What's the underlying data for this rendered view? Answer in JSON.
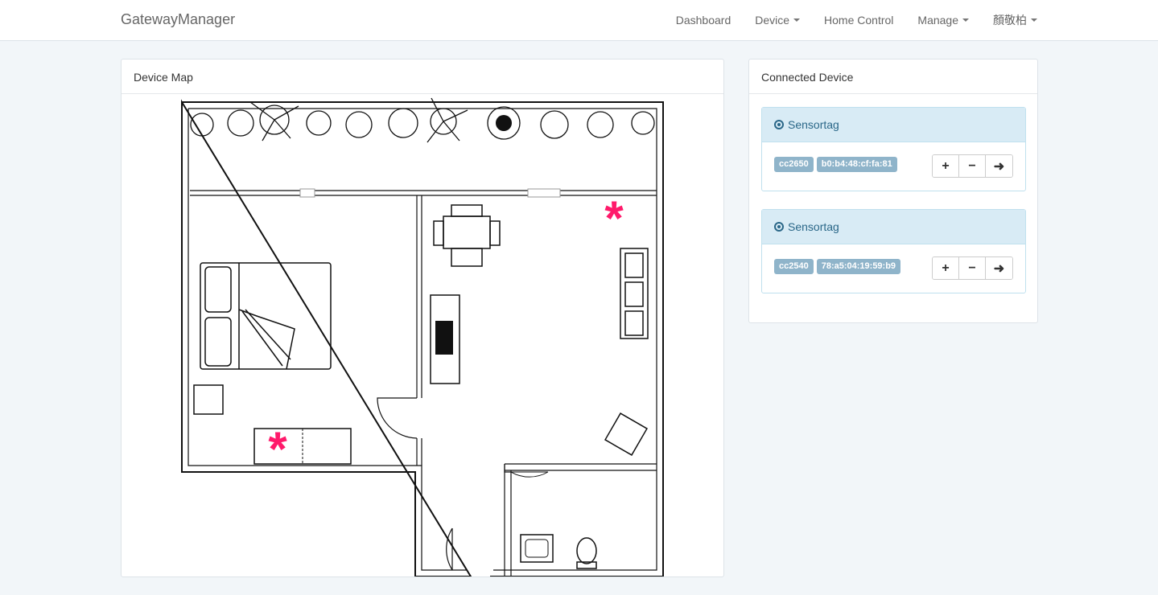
{
  "navbar": {
    "brand": "GatewayManager",
    "items": [
      {
        "label": "Dashboard",
        "dropdown": false
      },
      {
        "label": "Device",
        "dropdown": true
      },
      {
        "label": "Home Control",
        "dropdown": false
      },
      {
        "label": "Manage",
        "dropdown": true
      },
      {
        "label": "顏敬柏",
        "dropdown": true
      }
    ]
  },
  "map_panel": {
    "title": "Device Map",
    "marker_color": "#ff1a6b"
  },
  "devices_panel": {
    "title": "Connected Device",
    "devices": [
      {
        "name": "Sensortag",
        "chip": "cc2650",
        "mac": "b0:b4:48:cf:fa:81"
      },
      {
        "name": "Sensortag",
        "chip": "cc2540",
        "mac": "78:a5:04:19:59:b9"
      }
    ],
    "buttons": {
      "add": "+",
      "remove": "−",
      "go": "➜"
    },
    "icons": {
      "device": "radio-icon",
      "add": "plus-icon",
      "remove": "minus-icon",
      "go": "arrow-right-icon"
    }
  },
  "colors": {
    "accent": "#2a6788",
    "label_bg": "#8fb4ca",
    "device_head_bg": "#d8ebf5"
  }
}
